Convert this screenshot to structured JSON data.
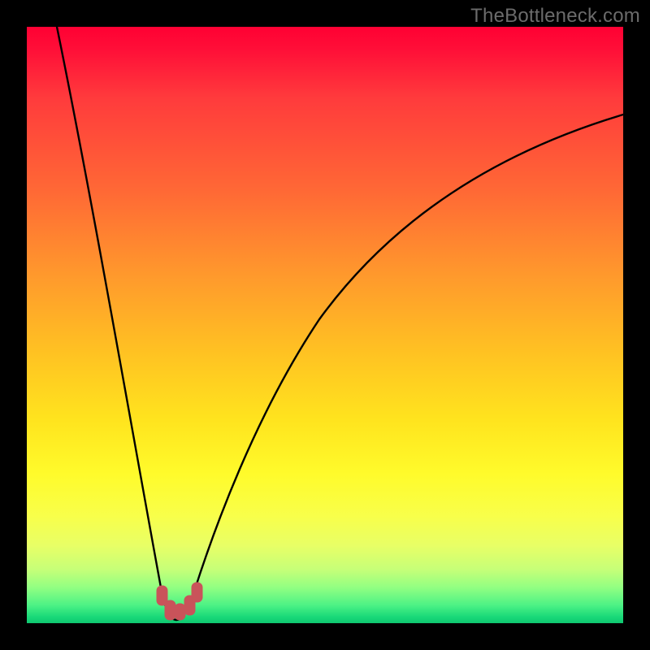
{
  "watermark": "TheBottleneck.com",
  "colors": {
    "frame": "#000000",
    "gradient_top": "#ff0033",
    "gradient_mid": "#ffe41e",
    "gradient_bottom": "#0fc770",
    "curve": "#000000",
    "marker": "#c85055"
  },
  "chart_data": {
    "type": "line",
    "title": "",
    "xlabel": "",
    "ylabel": "",
    "xlim": [
      0,
      100
    ],
    "ylim": [
      0,
      100
    ],
    "x": [
      0,
      2,
      4,
      6,
      8,
      10,
      12,
      14,
      16,
      18,
      20,
      22,
      23,
      24,
      25,
      26,
      28,
      30,
      34,
      38,
      42,
      46,
      50,
      55,
      60,
      65,
      70,
      75,
      80,
      85,
      90,
      95,
      100
    ],
    "values": [
      100,
      92,
      84,
      76,
      68,
      59,
      50,
      41,
      31,
      21,
      11,
      3,
      0.5,
      0,
      0.5,
      3,
      11,
      19,
      32,
      42,
      50,
      56,
      61,
      66,
      70,
      73,
      76,
      78.5,
      80.5,
      82,
      83.5,
      84.5,
      85.5
    ],
    "annotations": [
      {
        "type": "marker_cluster",
        "x_center": 24,
        "y_center": 1.2,
        "note": "red rounded markers at curve minimum"
      }
    ]
  }
}
